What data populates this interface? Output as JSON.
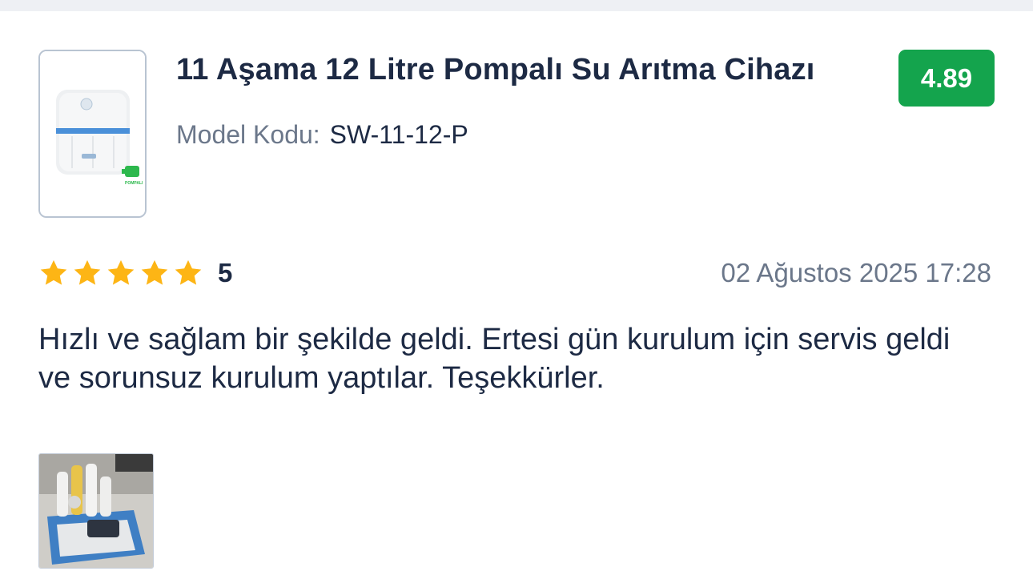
{
  "product": {
    "title": "11 Aşama 12 Litre Pompalı Su Arıtma Cihazı",
    "model_label": "Model Kodu:",
    "model_code": "SW-11-12-P",
    "score": "4.89",
    "image_caption": "POMPALI"
  },
  "review": {
    "rating": "5",
    "stars_filled": 5,
    "stars_total": 5,
    "date": "02 Ağustos 2025 17:28",
    "text_line1": "Hızlı ve sağlam bir şekilde geldi. Ertesi gün kurulum için servis geldi",
    "text_line2": "ve sorunsuz kurulum yaptılar. Teşekkürler."
  },
  "colors": {
    "accent": "#14a44d",
    "star": "#fdb515",
    "text": "#1d2a44",
    "muted": "#6b778a"
  }
}
